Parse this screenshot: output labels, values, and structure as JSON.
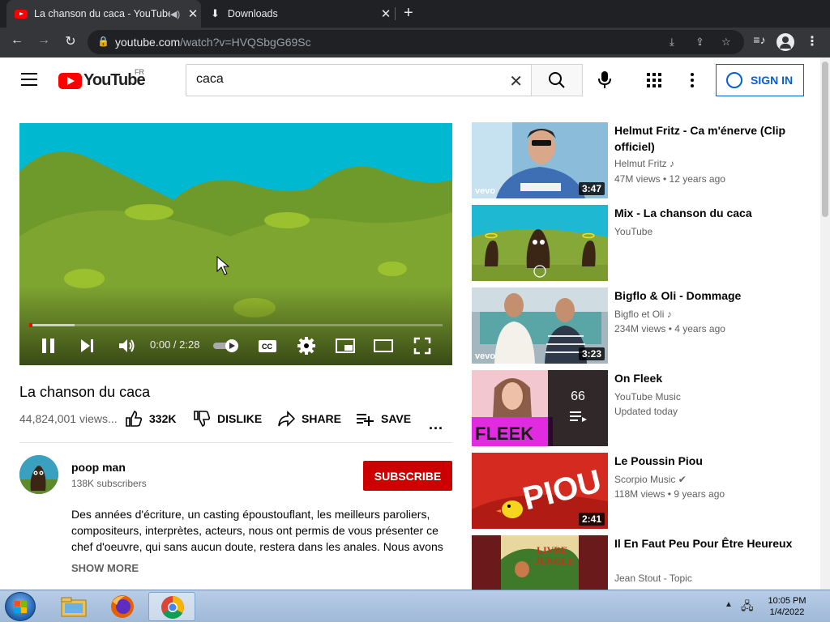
{
  "browser": {
    "tabs": [
      {
        "title": "La chanson du caca - YouTube",
        "active": true
      },
      {
        "title": "Downloads",
        "active": false
      }
    ],
    "url_host": "youtube.com",
    "url_path": "/watch?v=HVQSbgG69Sc"
  },
  "header": {
    "logo_text": "YouTube",
    "region": "FR",
    "search_value": "caca",
    "signin_label": "SIGN IN"
  },
  "player": {
    "time": "0:00 / 2:28",
    "progress_fraction": 0.0,
    "loaded_fraction": 0.11
  },
  "video": {
    "title": "La chanson du caca",
    "views": "44,824,001 views...",
    "like_count": "332K",
    "dislike_label": "DISLIKE",
    "share_label": "SHARE",
    "save_label": "SAVE",
    "more_label": "..."
  },
  "channel": {
    "name": "poop man",
    "subscribers": "138K subscribers",
    "subscribe_label": "SUBSCRIBE",
    "description": "Des années d'écriture, un casting époustouflant, les meilleurs paroliers, compositeurs, interprètes, acteurs, nous ont permis de vous présenter ce chef d'oeuvre, qui sans aucun doute, restera dans les anales. Nous avons le",
    "show_more": "SHOW MORE"
  },
  "recommendations": [
    {
      "title_line1": "Helmut Fritz - Ca m'énerve (Clip",
      "title_line2": "officiel)",
      "channel": "Helmut Fritz ♪",
      "meta": "47M views • 12 years ago",
      "duration": "3:47",
      "vevo": "vevo"
    },
    {
      "title_line1": "Mix - La chanson du caca",
      "title_line2": "",
      "channel": "YouTube",
      "meta": "",
      "duration": "",
      "vevo": ""
    },
    {
      "title_line1": "Bigflo & Oli - Dommage",
      "title_line2": "",
      "channel": "Bigflo et Oli ♪",
      "meta": "234M views • 4 years ago",
      "duration": "3:23",
      "vevo": "vevo"
    },
    {
      "title_line1": "On Fleek",
      "title_line2": "",
      "channel": "YouTube Music",
      "meta": "Updated today",
      "duration": "",
      "vevo": "",
      "playlist_count": "66"
    },
    {
      "title_line1": "Le Poussin Piou",
      "title_line2": "",
      "channel": "Scorpio Music ✔",
      "meta": "118M views • 9 years ago",
      "duration": "2:41",
      "vevo": ""
    },
    {
      "title_line1": "Il En Faut Peu Pour Être",
      "title_line2": "Heureux",
      "channel": "Jean Stout - Topic",
      "meta": "",
      "duration": "",
      "vevo": ""
    }
  ],
  "taskbar": {
    "time": "10:05 PM",
    "date": "1/4/2022"
  }
}
